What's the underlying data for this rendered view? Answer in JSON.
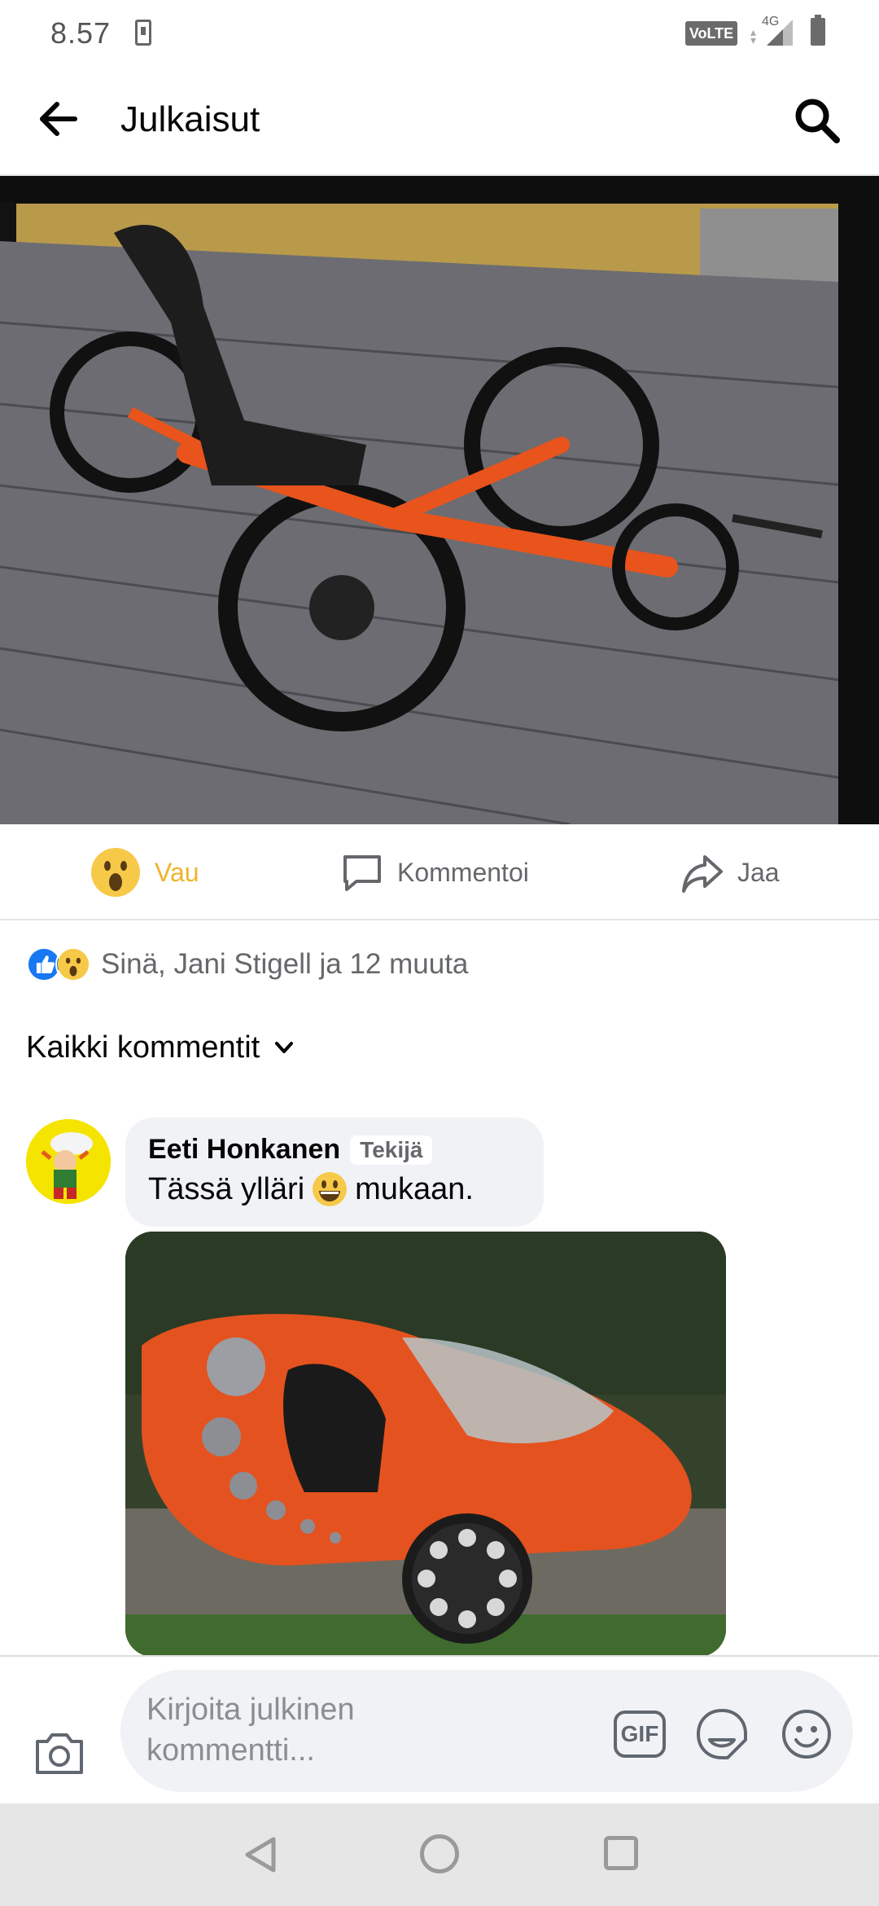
{
  "status_bar": {
    "time": "8.57",
    "volte": "VoLTE",
    "network": "4G"
  },
  "header": {
    "title": "Julkaisut"
  },
  "actions": {
    "reaction_label": "Vau",
    "comment_label": "Kommentoi",
    "share_label": "Jaa"
  },
  "reactions": {
    "summary": "Sinä, Jani Stigell ja 12 muuta"
  },
  "comments_filter": {
    "label": "Kaikki kommentit"
  },
  "comments": [
    {
      "author": "Eeti Honkanen",
      "badge": "Tekijä",
      "text_before": "Tässä ylläri",
      "text_after": "mukaan."
    }
  ],
  "composer": {
    "placeholder": "Kirjoita julkinen kommentti...",
    "gif_label": "GIF"
  },
  "icons": {
    "back": "arrow-left-icon",
    "search": "search-icon",
    "comment": "speech-bubble-icon",
    "share": "share-arrow-icon",
    "camera": "camera-icon",
    "sticker": "sticker-icon",
    "emoji": "emoji-icon"
  },
  "colors": {
    "accent_reaction": "#f0b429",
    "like_blue": "#1877f2",
    "text_secondary": "#65676b",
    "bubble_bg": "#f0f2f5"
  }
}
